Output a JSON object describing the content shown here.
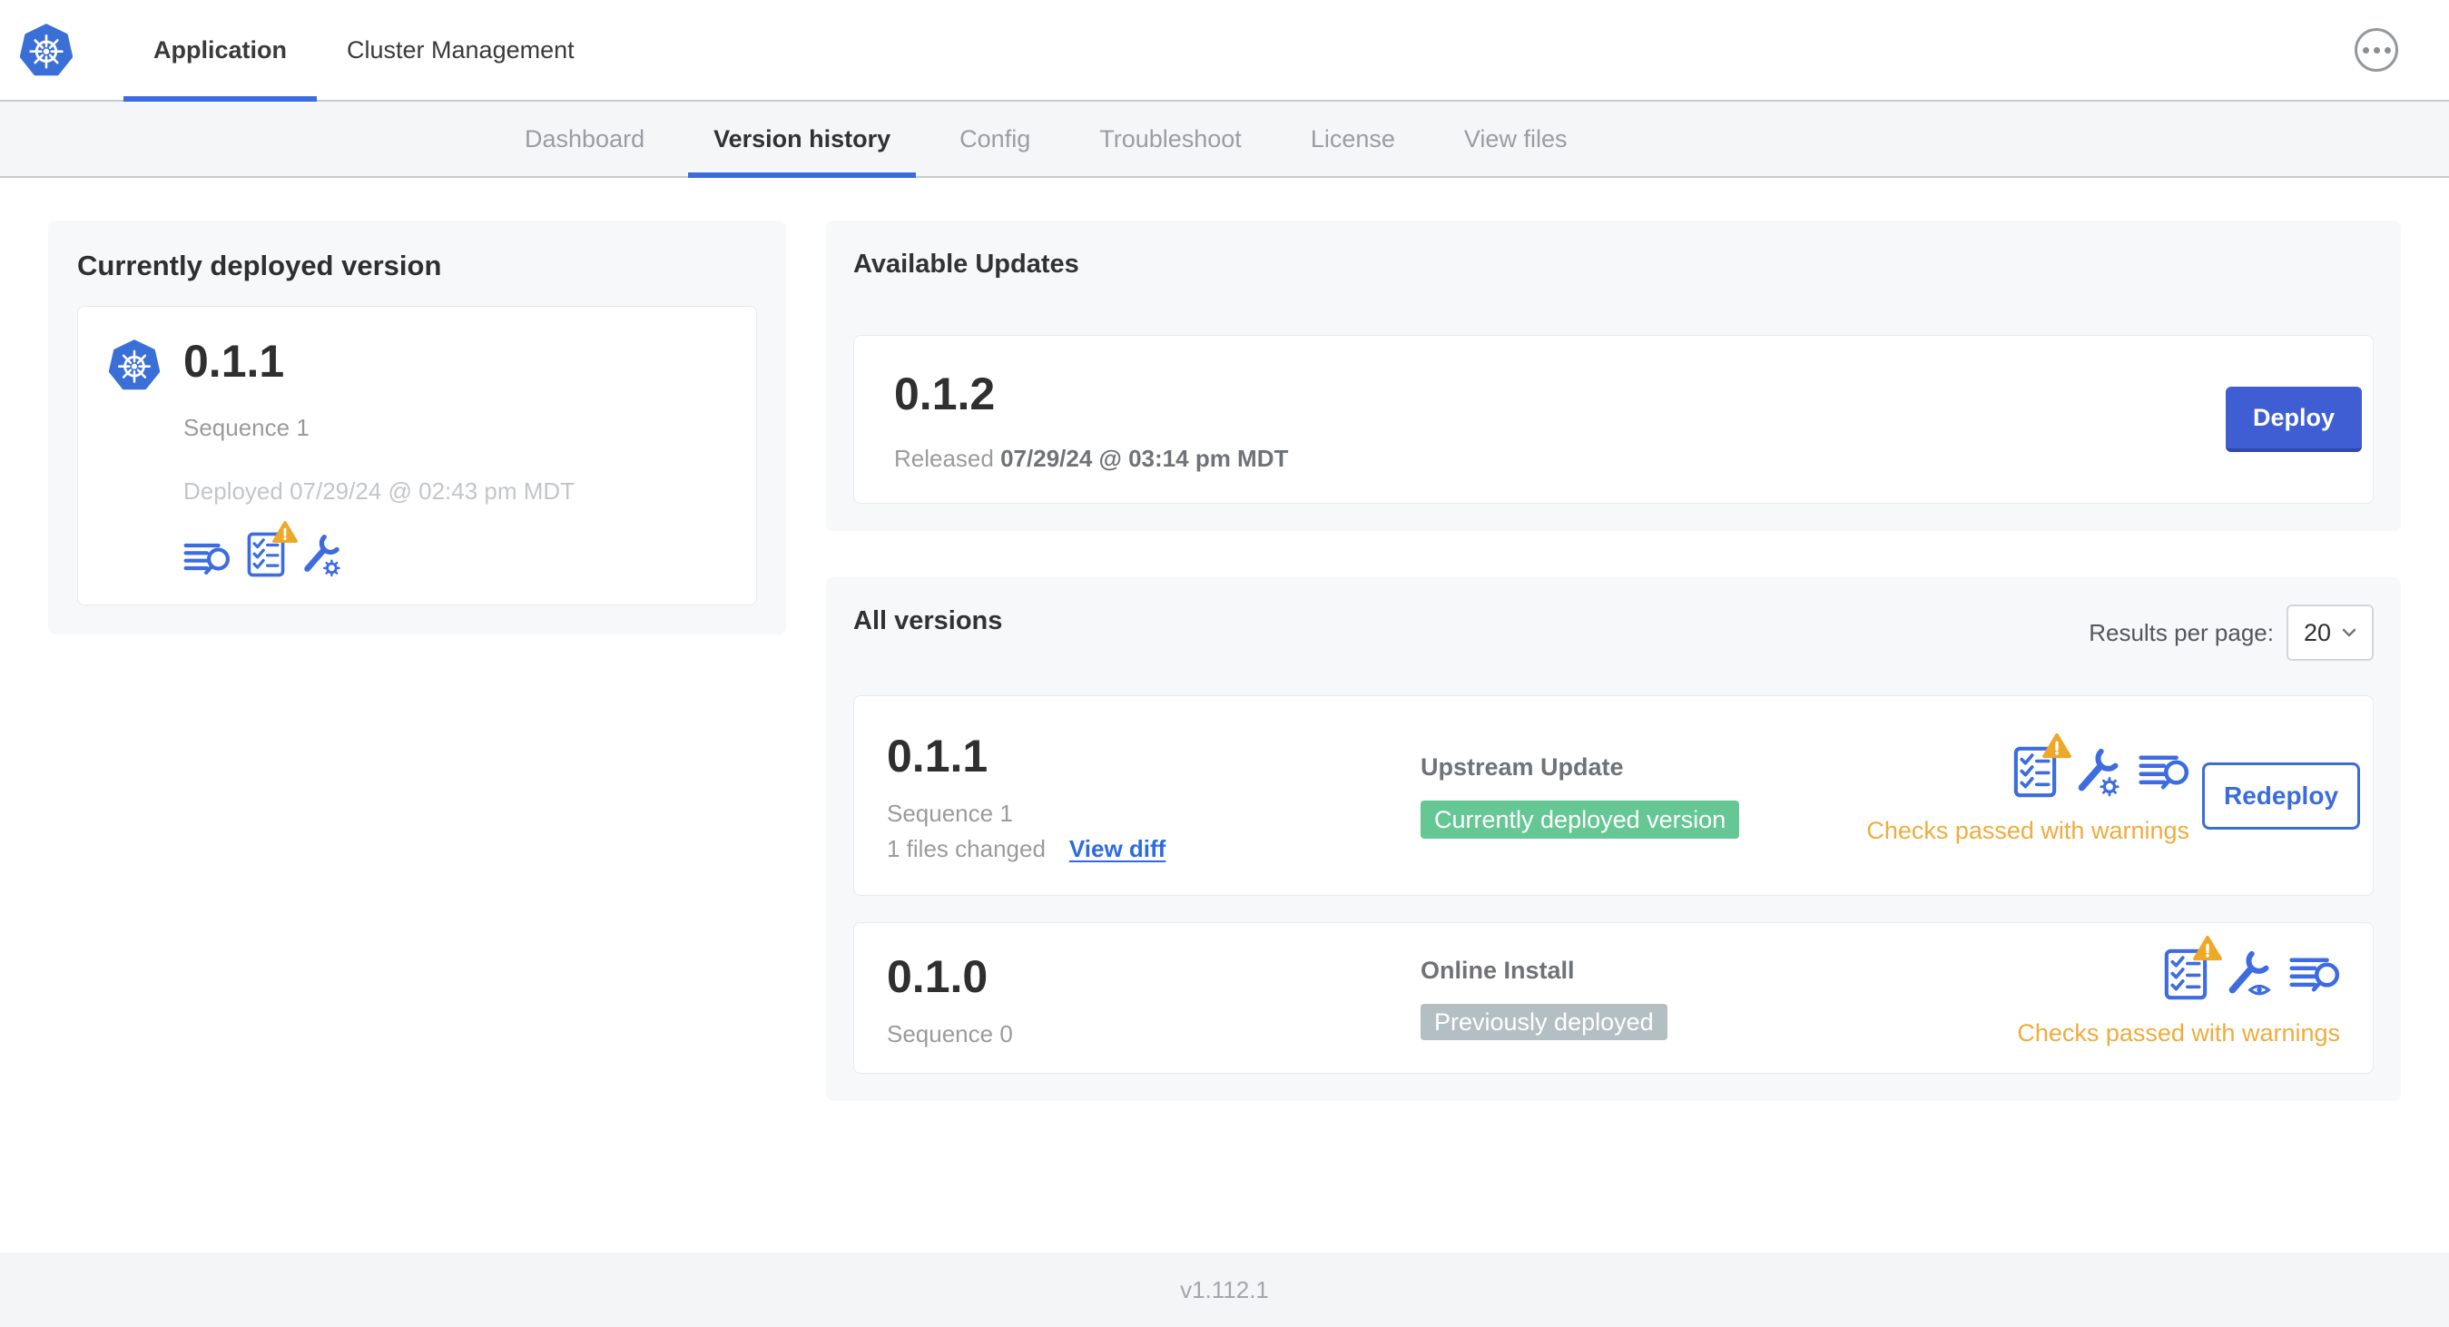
{
  "header": {
    "tabs": [
      {
        "label": "Application",
        "active": true
      },
      {
        "label": "Cluster Management",
        "active": false
      }
    ],
    "menu_icon": "ellipsis-menu-icon"
  },
  "subnav": {
    "items": [
      {
        "label": "Dashboard",
        "active": false
      },
      {
        "label": "Version history",
        "active": true
      },
      {
        "label": "Config",
        "active": false
      },
      {
        "label": "Troubleshoot",
        "active": false
      },
      {
        "label": "License",
        "active": false
      },
      {
        "label": "View files",
        "active": false
      }
    ]
  },
  "current_version": {
    "title": "Currently deployed version",
    "version": "0.1.1",
    "sequence": "Sequence 1",
    "deployed": "Deployed 07/29/24 @ 02:43 pm MDT",
    "icons": [
      "logs-search-icon",
      "preflight-checks-warning-icon",
      "config-wrench-gear-icon"
    ]
  },
  "available_updates": {
    "title": "Available Updates",
    "version": "0.1.2",
    "released_label": "Released",
    "released_date": "07/29/24 @ 03:14 pm MDT",
    "deploy_label": "Deploy"
  },
  "all_versions": {
    "title": "All versions",
    "results_per_page_label": "Results per page:",
    "results_per_page": "20",
    "rows": [
      {
        "version": "0.1.1",
        "sequence": "Sequence 1",
        "files_changed": "1 files changed",
        "view_diff_label": "View diff",
        "source": "Upstream Update",
        "badge": "Currently deployed version",
        "badge_color": "#65c894",
        "status": "Checks passed with warnings",
        "action_label": "Redeploy",
        "icons": [
          "preflight-checks-warning-icon",
          "config-wrench-gear-icon",
          "logs-search-icon"
        ]
      },
      {
        "version": "0.1.0",
        "sequence": "Sequence 0",
        "source": "Online Install",
        "badge": "Previously deployed",
        "badge_color": "#b4bfc3",
        "status": "Checks passed with warnings",
        "icons": [
          "preflight-checks-warning-icon",
          "view-config-wrench-eye-icon",
          "logs-search-icon"
        ]
      }
    ]
  },
  "footer": {
    "app_version": "v1.112.1"
  },
  "colors": {
    "accent_blue": "#3b6cdd",
    "button_blue": "#3f5ed4",
    "badge_green": "#65c894",
    "badge_gray": "#b4bfc3",
    "warning_amber": "#efac3d",
    "kubernetes_blue": "#3b6fd8"
  }
}
